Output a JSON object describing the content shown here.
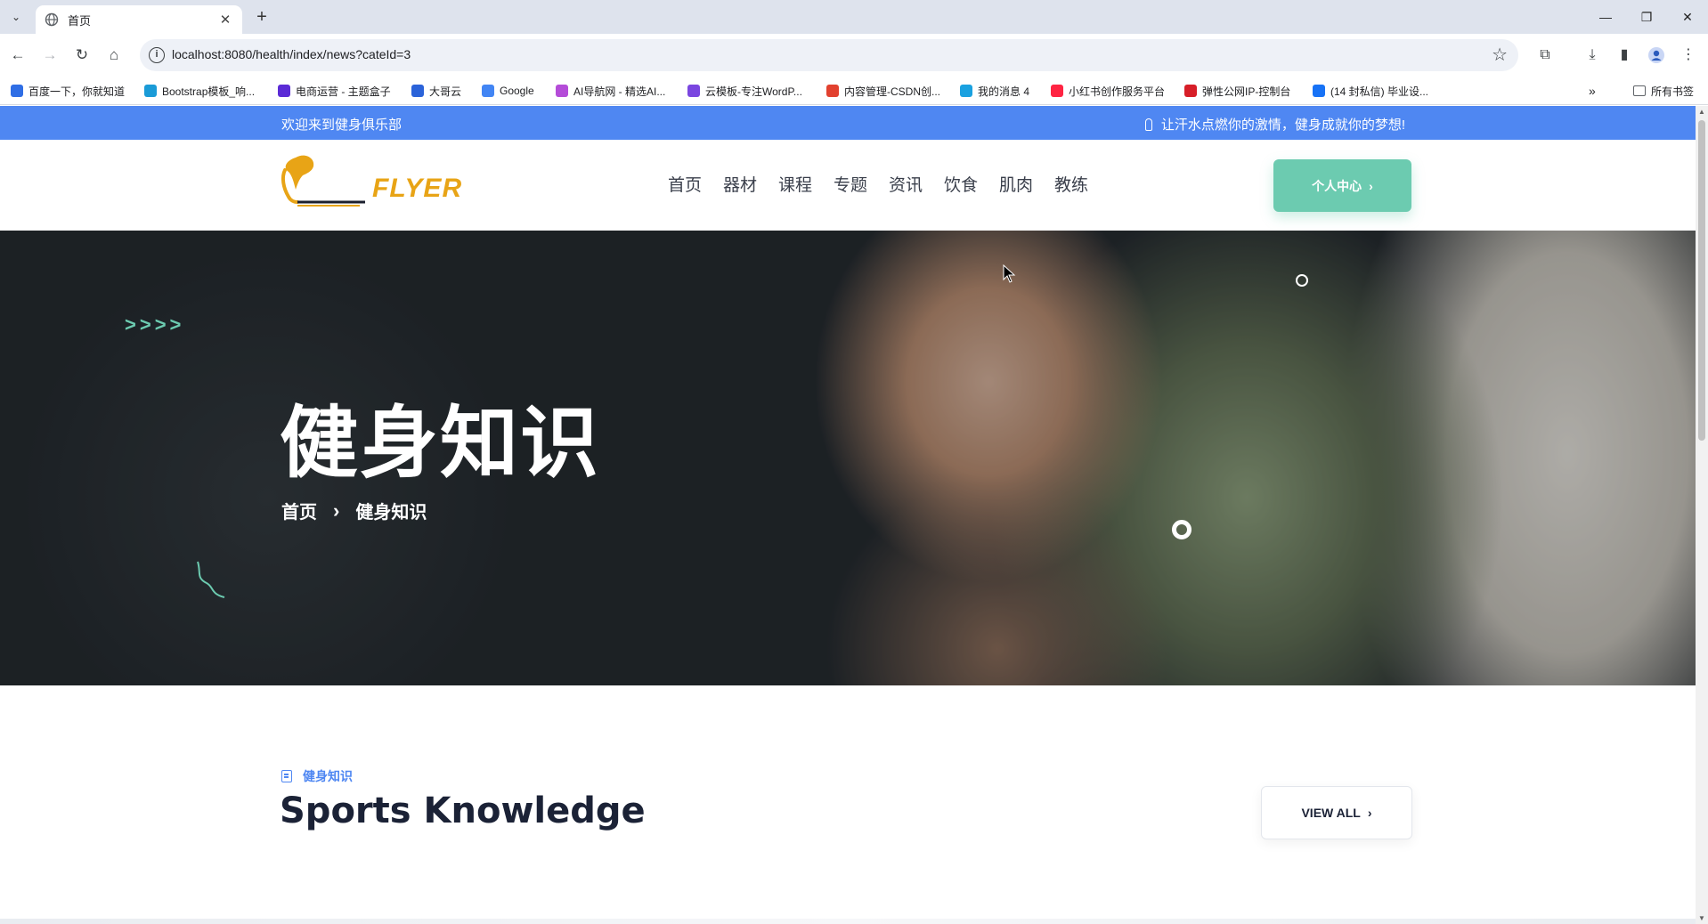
{
  "browser": {
    "tab_title": "首页",
    "url": "localhost:8080/health/index/news?cateId=3",
    "bookmarks": [
      {
        "label": "百度一下，你就知道",
        "color": "#2f6ee5"
      },
      {
        "label": "Bootstrap模板_响...",
        "color": "#1a9bd7"
      },
      {
        "label": "电商运营 - 主题盒子",
        "color": "#5b2bd6"
      },
      {
        "label": "大哥云",
        "color": "#2b63d9"
      },
      {
        "label": "Google",
        "color": "#4285f4"
      },
      {
        "label": "AI导航网 - 精选AI...",
        "color": "#b44cd8"
      },
      {
        "label": "云模板-专注WordP...",
        "color": "#7a46e0"
      },
      {
        "label": "内容管理-CSDN创...",
        "color": "#e2412f"
      },
      {
        "label": "我的消息 4",
        "color": "#1aa1e0"
      },
      {
        "label": "小红书创作服务平台",
        "color": "#ff2442"
      },
      {
        "label": "弹性公网IP-控制台",
        "color": "#d71e28"
      },
      {
        "label": "(14 封私信) 毕业设...",
        "color": "#1772f6"
      }
    ],
    "all_bookmarks": "所有书签"
  },
  "site": {
    "topbar": {
      "welcome": "欢迎来到健身俱乐部",
      "slogan": "让汗水点燃你的激情，健身成就你的梦想!"
    },
    "logo_text": "FLYER",
    "nav": [
      "首页",
      "器材",
      "课程",
      "专题",
      "资讯",
      "饮食",
      "肌肉",
      "教练"
    ],
    "user_center": "个人中心",
    "hero": {
      "title": "健身知识",
      "breadcrumb_home": "首页",
      "breadcrumb_current": "健身知识"
    },
    "section": {
      "kicker": "健身知识",
      "title": "Sports Knowledge",
      "view_all": "VIEW ALL"
    }
  },
  "colors": {
    "topbar": "#4f87f2",
    "accent_green": "#6ccbb0",
    "logo_yellow": "#e8a416"
  }
}
